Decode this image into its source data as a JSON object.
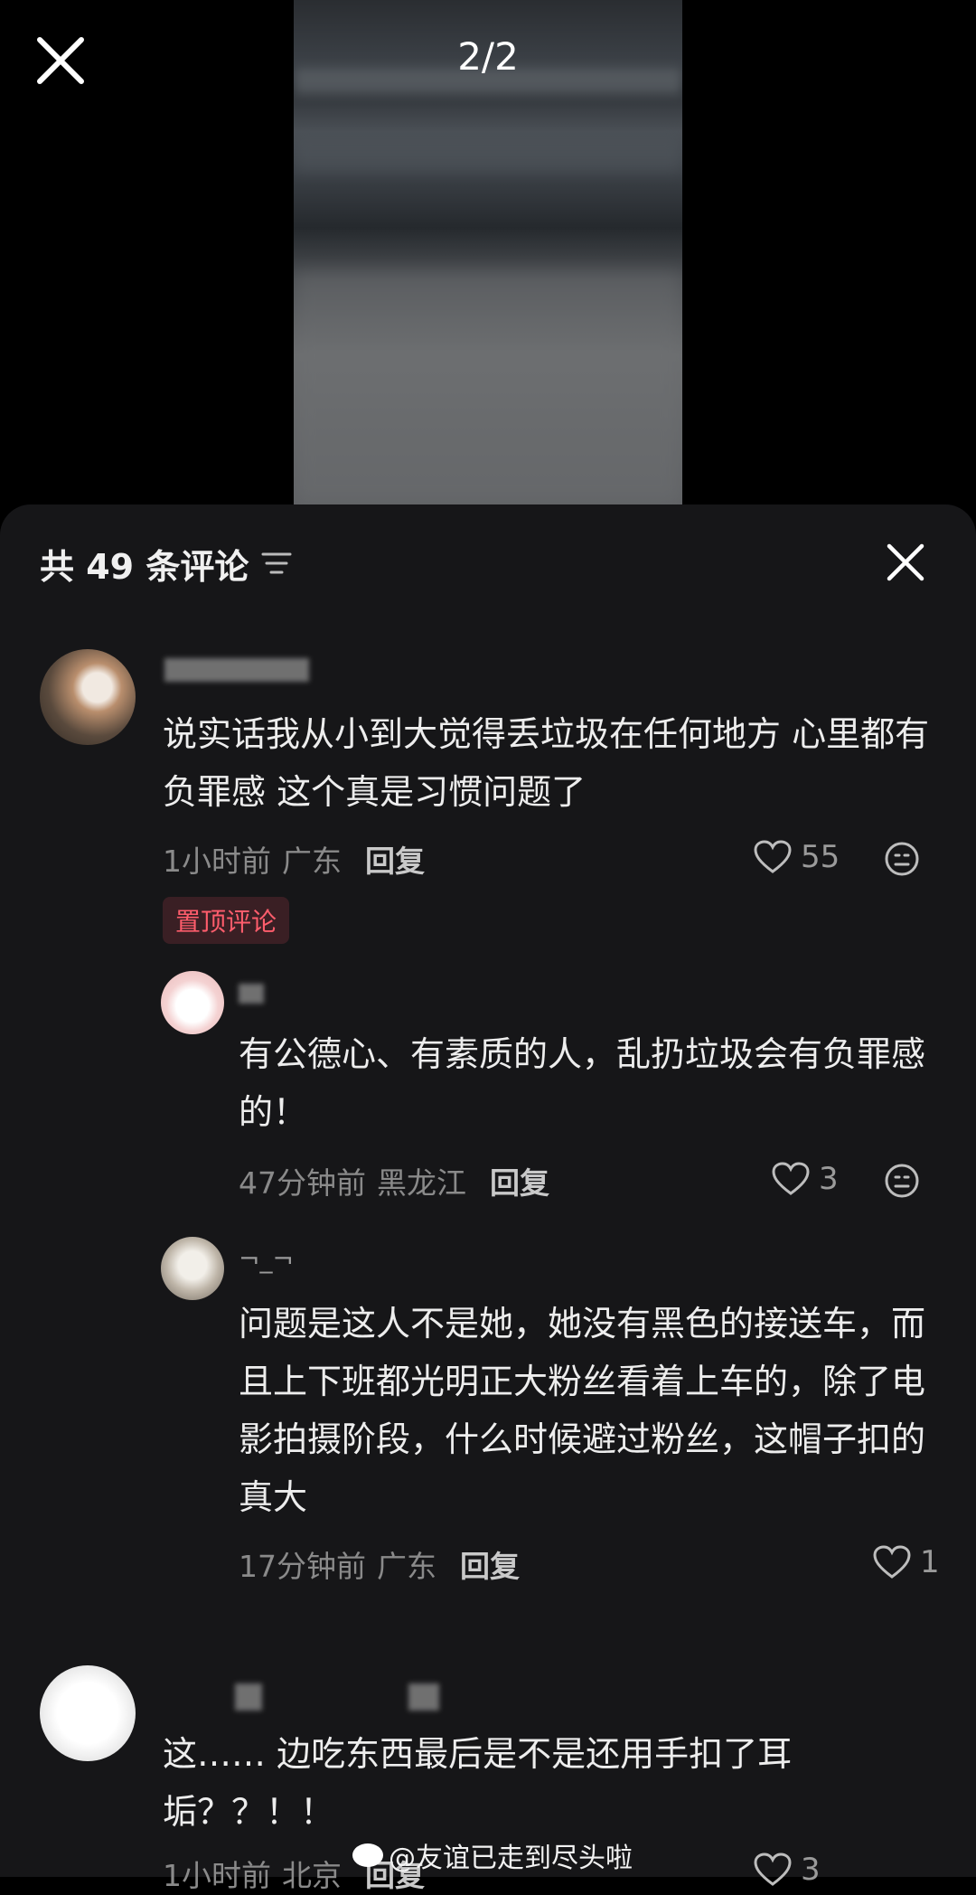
{
  "viewer": {
    "page_indicator": "2/2"
  },
  "comments_sheet": {
    "title": "共 49 条评论",
    "comments": [
      {
        "text": "说实话我从小到大觉得丢垃圾在任何地方 心里都有负罪感 这个真是习惯问题了",
        "time": "1小时前",
        "location": "广东",
        "reply_label": "回复",
        "likes": "55",
        "pinned_label": "置顶评论"
      },
      {
        "text": "有公德心、有素质的人，乱扔垃圾会有负罪感的！",
        "time": "47分钟前",
        "location": "黑龙江",
        "reply_label": "回复",
        "likes": "3"
      },
      {
        "username": "¬_¬",
        "text": "问题是这人不是她，她没有黑色的接送车，而且上下班都光明正大粉丝看着上车的，除了电影拍摄阶段，什么时候避过粉丝，这帽子扣的真大",
        "time": "17分钟前",
        "location": "广东",
        "reply_label": "回复",
        "likes": "1"
      },
      {
        "text": "这……  边吃东西最后是不是还用手扣了耳垢？？！！",
        "time": "1小时前",
        "location": "北京",
        "reply_label": "回复",
        "likes": "3"
      }
    ]
  },
  "watermark": "@友谊已走到尽头啦"
}
